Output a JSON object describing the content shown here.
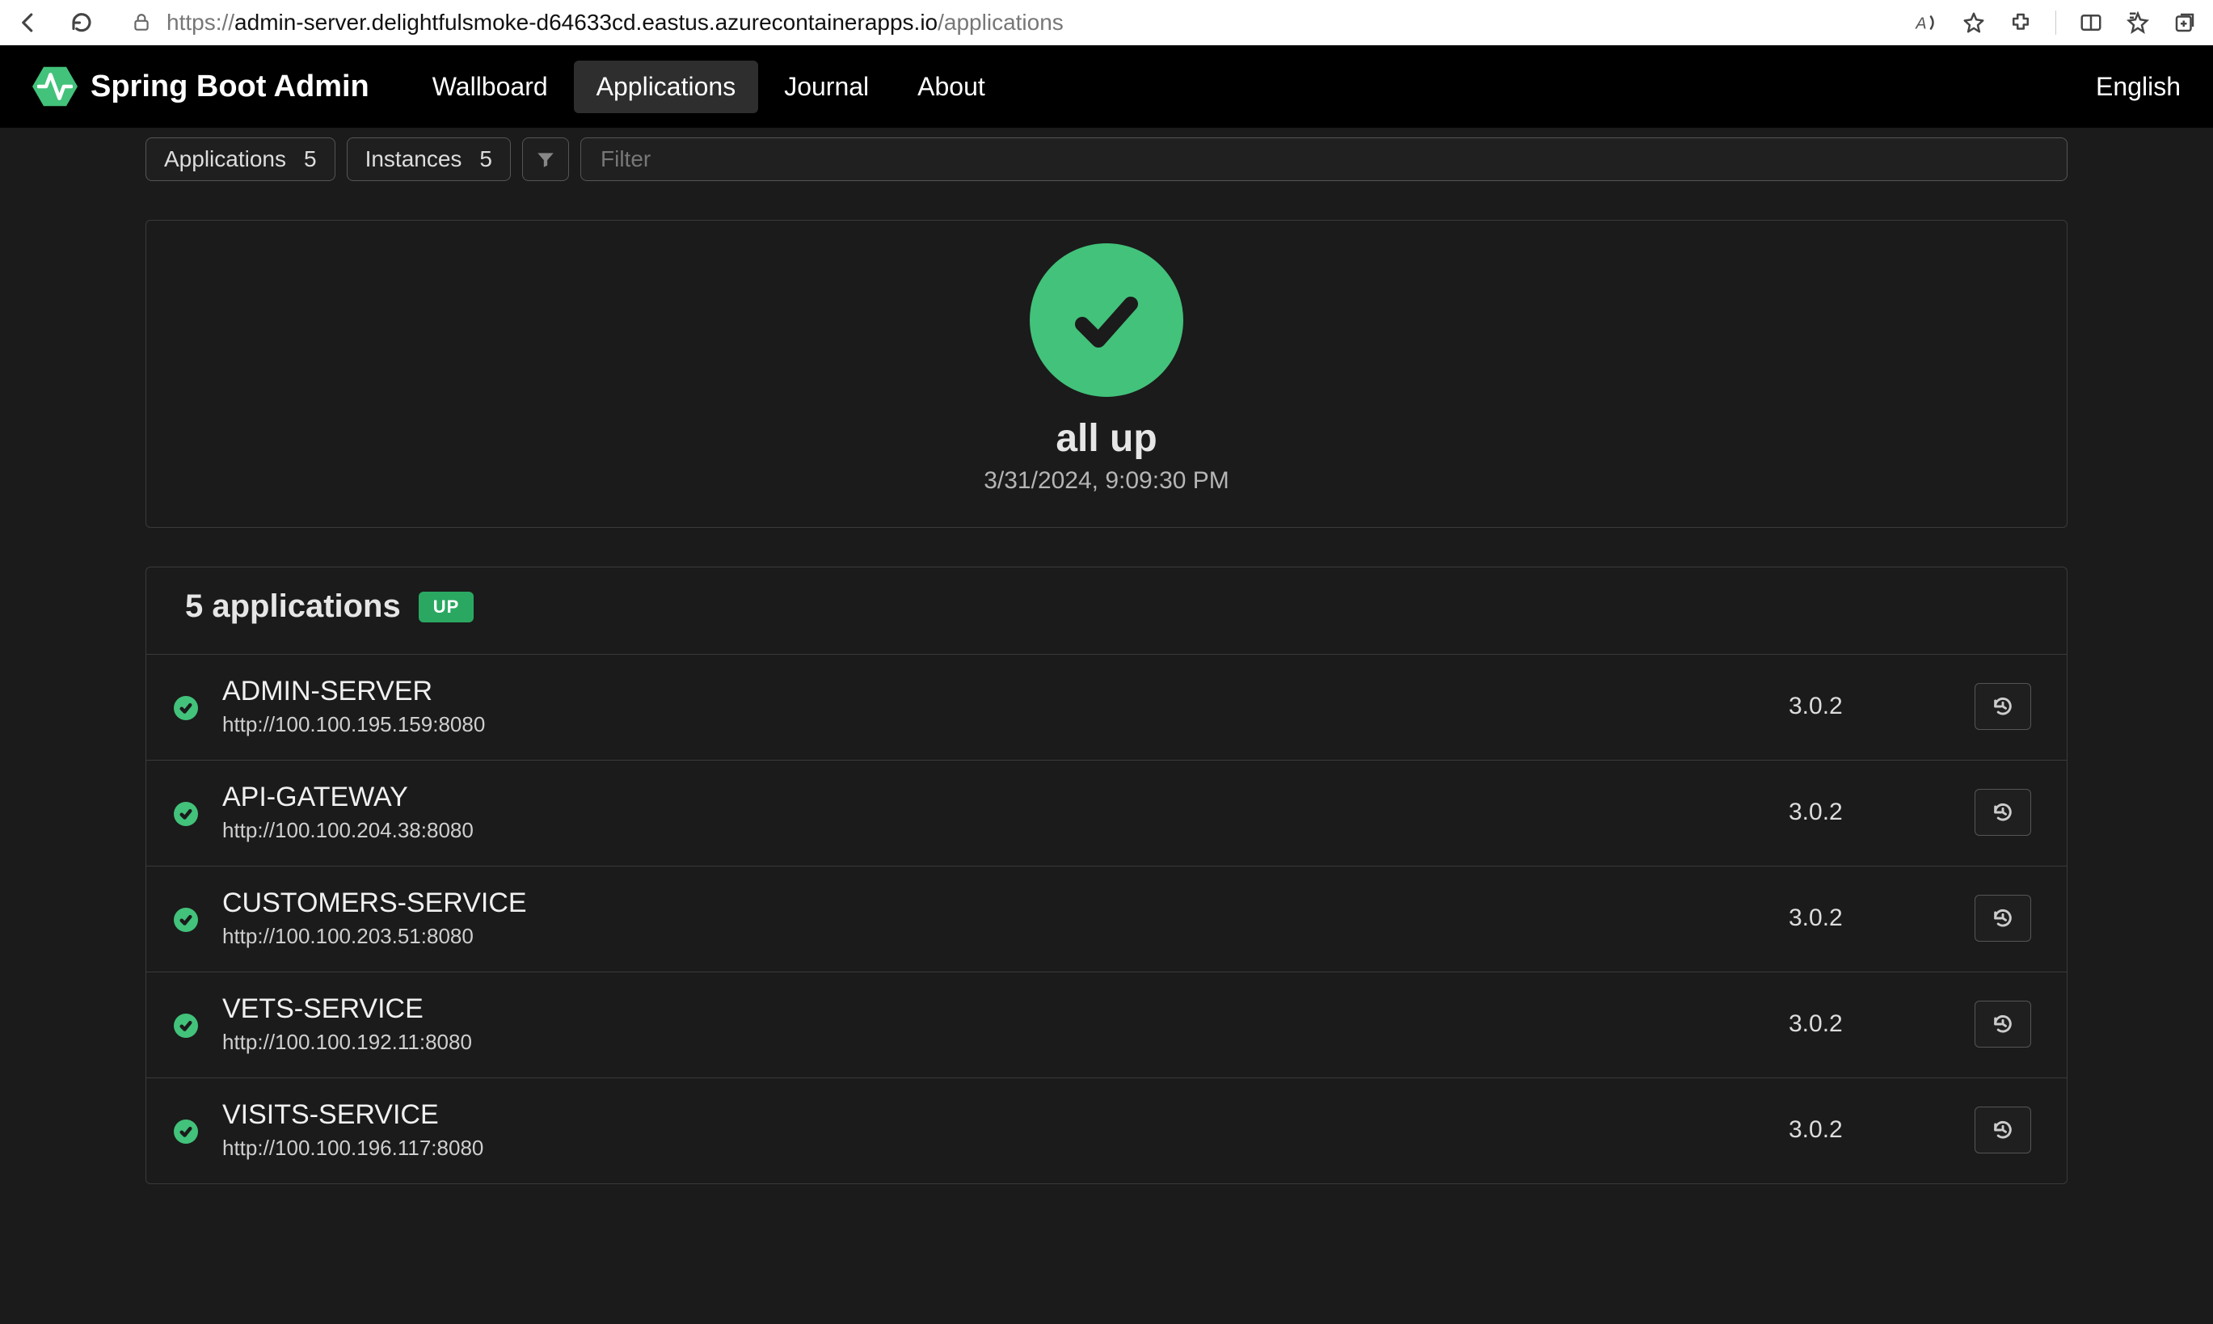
{
  "browser": {
    "url_prefix": "https://",
    "url_host": "admin-server.delightfulsmoke-d64633cd.eastus.azurecontainerapps.io",
    "url_path": "/applications"
  },
  "header": {
    "brand": "Spring Boot Admin",
    "nav": {
      "wallboard": "Wallboard",
      "applications": "Applications",
      "journal": "Journal",
      "about": "About"
    },
    "language": "English"
  },
  "toolbar": {
    "applications_label": "Applications",
    "applications_count": "5",
    "instances_label": "Instances",
    "instances_count": "5",
    "filter_placeholder": "Filter"
  },
  "status": {
    "title": "all up",
    "timestamp": "3/31/2024, 9:09:30 PM"
  },
  "apps": {
    "header_title": "5 applications",
    "badge": "UP",
    "rows": [
      {
        "name": "ADMIN-SERVER",
        "url": "http://100.100.195.159:8080",
        "version": "3.0.2"
      },
      {
        "name": "API-GATEWAY",
        "url": "http://100.100.204.38:8080",
        "version": "3.0.2"
      },
      {
        "name": "CUSTOMERS-SERVICE",
        "url": "http://100.100.203.51:8080",
        "version": "3.0.2"
      },
      {
        "name": "VETS-SERVICE",
        "url": "http://100.100.192.11:8080",
        "version": "3.0.2"
      },
      {
        "name": "VISITS-SERVICE",
        "url": "http://100.100.196.117:8080",
        "version": "3.0.2"
      }
    ]
  },
  "colors": {
    "green": "#42c27a",
    "bg": "#1b1b1b"
  }
}
